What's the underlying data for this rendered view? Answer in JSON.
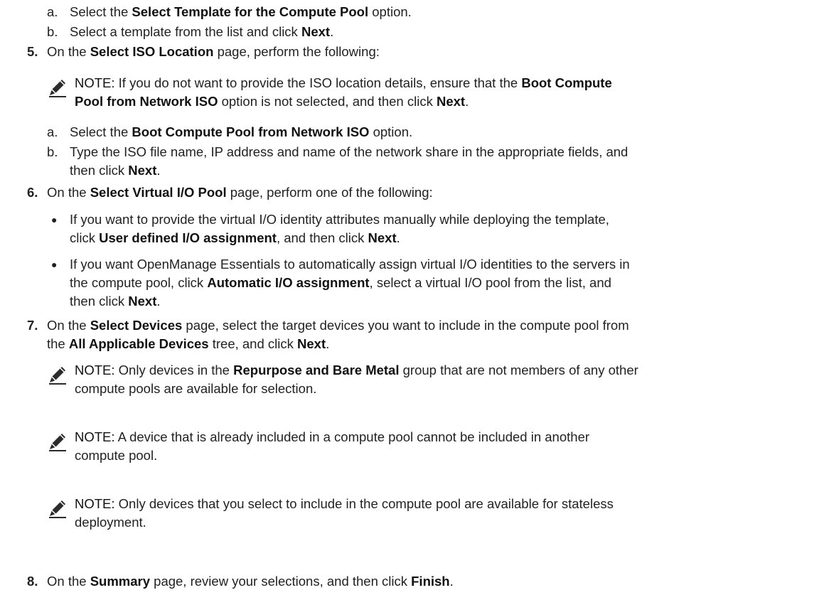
{
  "step4": {
    "a": {
      "marker": "a.",
      "pre": "Select the ",
      "bold": "Select Template for the Compute Pool",
      "post": " option."
    },
    "b": {
      "marker": "b.",
      "pre": "Select a template from the list and click ",
      "bold": "Next",
      "post": "."
    }
  },
  "step5": {
    "num": "5.",
    "pre": "On the ",
    "bold": "Select ISO Location",
    "post": " page, perform the following:",
    "note": {
      "head": "NOTE:",
      "t1": " If you do not want to provide the ISO location details, ensure that the ",
      "b1": "Boot Compute",
      "b2": "Pool from Network ISO",
      "t2": " option is not selected, and then click ",
      "b3": "Next",
      "t3": "."
    },
    "a": {
      "marker": "a.",
      "pre": "Select the ",
      "bold": "Boot Compute Pool from Network ISO",
      "post": " option."
    },
    "b": {
      "marker": "b.",
      "line1": "Type the ISO file name, IP address and name of the network share in the appropriate fields, and",
      "line2pre": "then click ",
      "bold": "Next",
      "post": "."
    }
  },
  "step6": {
    "num": "6.",
    "pre": "On the ",
    "bold": "Select Virtual I/O Pool",
    "post": " page, perform one of the following:",
    "bullet1": {
      "line1": "If you want to provide the virtual I/O identity attributes manually while deploying the template,",
      "pre": "click ",
      "bold": "User defined I/O assignment",
      "mid": ", and then click ",
      "bold2": "Next",
      "post": "."
    },
    "bullet2": {
      "line1": "If you want OpenManage Essentials to automatically assign virtual I/O identities to the servers in",
      "pre": "the compute pool, click ",
      "bold": "Automatic I/O assignment",
      "post": ", select a virtual I/O pool from the list, and",
      "line3pre": "then click ",
      "bold2": "Next",
      "line3post": "."
    }
  },
  "step7": {
    "num": "7.",
    "pre": "On the ",
    "bold": "Select Devices",
    "post": " page, select the target devices you want to include in the compute pool from",
    "line2pre": "the ",
    "bold2": "All Applicable Devices",
    "line2post": " tree, and click ",
    "bold3": "Next",
    "line2end": ".",
    "note1": {
      "head": "NOTE:",
      "pre": " Only devices in the ",
      "bold": "Repurpose and Bare Metal",
      "post": " group that are not members of any other",
      "line2": "compute pools are available for selection."
    },
    "note2": {
      "head": "NOTE:",
      "line1": " A device that is already included in a compute pool cannot be included in another",
      "line2": "compute pool."
    },
    "note3": {
      "head": "NOTE:",
      "line1": " Only devices that you select to include in the compute pool are available for stateless",
      "line2": "deployment."
    }
  },
  "step8": {
    "num": "8.",
    "pre": "On the ",
    "bold": "Summary",
    "mid": " page, review your selections, and then click ",
    "bold2": "Finish",
    "post": "."
  },
  "icons": {
    "note": "pencil-note-icon"
  },
  "colors": {
    "text": "#222222",
    "icon": "#222222"
  }
}
